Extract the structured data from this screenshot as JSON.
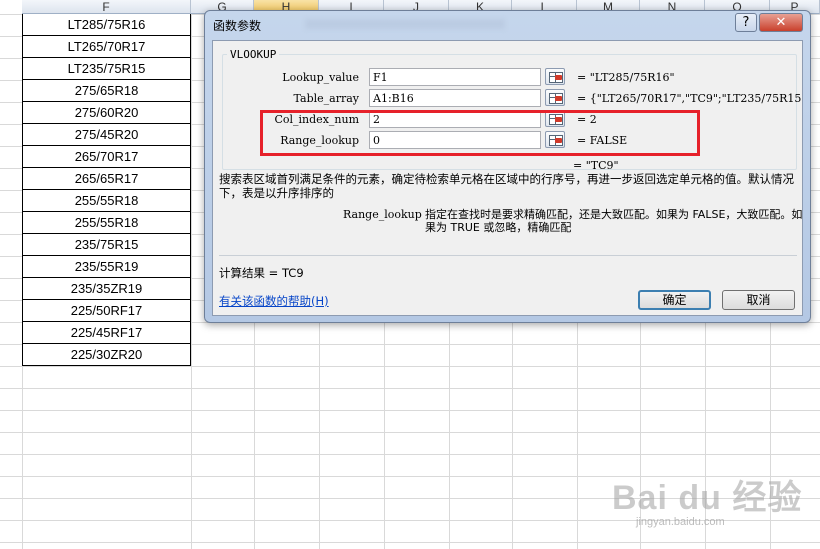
{
  "sheet": {
    "columns": [
      "F",
      "G",
      "H",
      "I",
      "J",
      "K",
      "L",
      "M",
      "N",
      "O",
      "P"
    ],
    "selected_column": "H",
    "f_values": [
      "LT285/75R16",
      "LT265/70R17",
      "LT235/75R15",
      "275/65R18",
      "275/60R20",
      "275/45R20",
      "265/70R17",
      "265/65R17",
      "255/55R18",
      "255/55R18",
      "235/75R15",
      "235/55R19",
      "235/35ZR19",
      "225/50RF17",
      "225/45RF17",
      "225/30ZR20"
    ]
  },
  "dialog": {
    "title": "函数参数",
    "help_button": "?",
    "close_button": "✕",
    "function_name": "VLOOKUP",
    "args": [
      {
        "label": "Lookup_value",
        "value": "F1",
        "result": "= \"LT285/75R16\""
      },
      {
        "label": "Table_array",
        "value": "A1:B16",
        "result": "= {\"LT265/70R17\",\"TC9\";\"LT235/75R15"
      },
      {
        "label": "Col_index_num",
        "value": "2",
        "result": "= 2"
      },
      {
        "label": "Range_lookup",
        "value": "0",
        "result": "= FALSE"
      }
    ],
    "overall_result": "= \"TC9\"",
    "description": "搜索表区域首列满足条件的元素，确定待检索单元格在区域中的行序号，再进一步返回选定单元格的值。默认情况下，表是以升序排序的",
    "arg_help_name": "Range_lookup",
    "arg_help_text": "指定在查找时是要求精确匹配，还是大致匹配。如果为 FALSE，大致匹配。如果为 TRUE 或忽略，精确匹配",
    "calc_result": "计算结果 =  TC9",
    "help_link": "有关该函数的帮助(H)",
    "ok_label": "确定",
    "cancel_label": "取消"
  },
  "watermark": {
    "logo": "Bai du 经验",
    "sub": "jingyan.baidu.com"
  },
  "colors": {
    "highlight": "#e6212a",
    "dialog_frame": "#b4c8e4",
    "link": "#0645c8"
  }
}
